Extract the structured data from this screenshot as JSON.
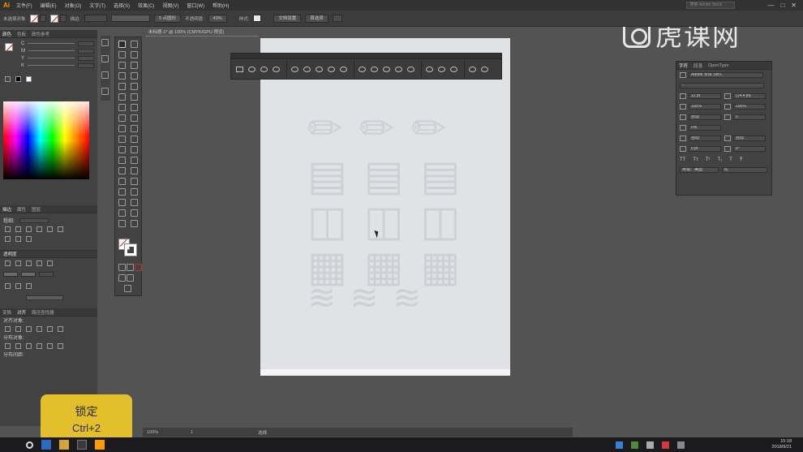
{
  "menubar": {
    "logo": "Ai",
    "items": [
      "文件(F)",
      "编辑(E)",
      "对象(O)",
      "文字(T)",
      "选择(S)",
      "效果(C)",
      "视图(V)",
      "窗口(W)",
      "帮助(H)"
    ],
    "search_placeholder": "搜索 Adobe Stock",
    "window_buttons": [
      "—",
      "□",
      "✕"
    ]
  },
  "controlbar": {
    "object_label": "未选择对象",
    "stroke_label": "描边:",
    "brush_label": "5 点圆形",
    "opacity_label": "不透明度:",
    "opacity_value": "40%",
    "style_label": "样式:",
    "doc_setup_button": "文档设置",
    "prefs_button": "首选项"
  },
  "leftpanel": {
    "tabs_top": [
      "颜色",
      "色板",
      "颜色参考"
    ],
    "color_rows": [
      "C",
      "M",
      "Y",
      "K"
    ],
    "tabs_middle": [
      "描边",
      "属性",
      "图层"
    ],
    "stroke_weight_label": "粗细:",
    "section_stroke_title": "透明度",
    "tabs_bottom": [
      "变换",
      "对齐",
      "路径查找器"
    ],
    "align_objects_label": "对齐对象:",
    "distribute_objects_label": "分布对象:",
    "distribute_spacing_label": "分布间距:"
  },
  "document": {
    "tab_title": "未标题-1* @ 100% (CMYK/GPU 预览)"
  },
  "charpanel": {
    "tabs": [
      "字符",
      "段落",
      "OpenType"
    ],
    "font_family": "Adobe 宋体 Std L",
    "font_style": "-",
    "font_size": "12 pt",
    "leading": "(14.4 pt)",
    "vscale": "100%",
    "hscale": "100%",
    "kerning": "自动",
    "tracking": "0",
    "tsume": "0%",
    "aki_left": "自动",
    "aki_right": "自动",
    "baseline": "0 pt",
    "rotation": "0°",
    "style_buttons": [
      "TT",
      "Tт",
      "T¹",
      "T₁",
      "T",
      "Ŧ"
    ],
    "language": "英语：美国",
    "aa": "a₂"
  },
  "statusbar": {
    "zoom": "100%",
    "page": "1",
    "tool": "选择"
  },
  "overlay": {
    "title": "锁定",
    "shortcut": "Ctrl+2"
  },
  "watermark": {
    "text": "虎课网"
  },
  "taskbar": {
    "time": "15:18",
    "date": "2018/9/21"
  },
  "colors": {
    "accent": "#e3bf2c",
    "ai_logo": "#ff9a00",
    "artboard": "#e0e2e6",
    "workspace": "#535353"
  }
}
